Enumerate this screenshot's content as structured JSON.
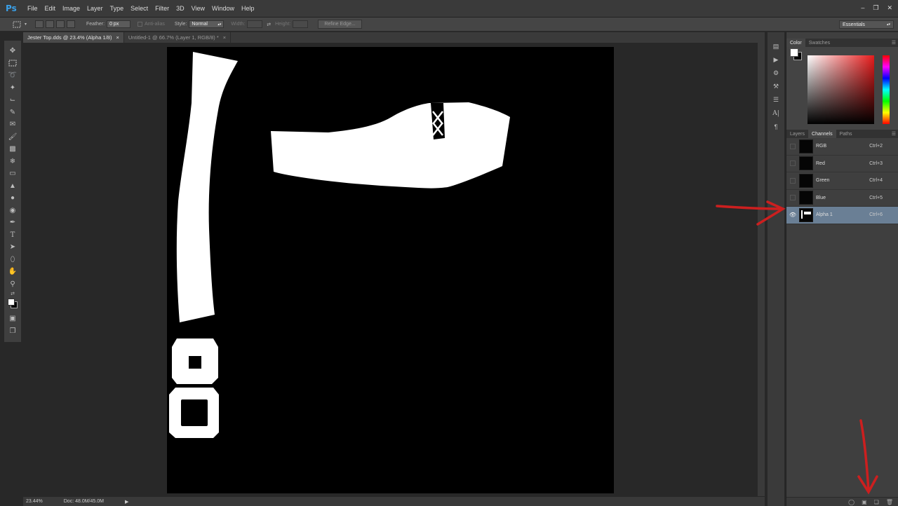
{
  "app": {
    "logo": "Ps"
  },
  "menu": [
    "File",
    "Edit",
    "Image",
    "Layer",
    "Type",
    "Select",
    "Filter",
    "3D",
    "View",
    "Window",
    "Help"
  ],
  "window_controls": [
    "minimize-icon",
    "restore-icon",
    "close-icon"
  ],
  "options": {
    "feather_label": "Feather:",
    "feather_value": "0 px",
    "antialias_label": "Anti-alias",
    "style_label": "Style:",
    "style_value": "Normal",
    "width_label": "Width:",
    "height_label": "Height:",
    "refine_edge": "Refine Edge...",
    "workspace": "Essentials"
  },
  "tabs": [
    {
      "label": "Jester Top.dds @ 23.4% (Alpha 1/8)",
      "close": "×"
    },
    {
      "label": "Untitled-1 @ 66.7% (Layer 1, RGB/8) *",
      "close": "×"
    }
  ],
  "status": {
    "zoom": "23.44%",
    "doc": "Doc: 48.0M/45.0M"
  },
  "color_panel": {
    "tabs": [
      "Color",
      "Swatches"
    ]
  },
  "channels_panel": {
    "tabs": [
      "Layers",
      "Channels",
      "Paths"
    ],
    "rows": [
      {
        "name": "RGB",
        "shortcut": "Ctrl+2",
        "visible": false
      },
      {
        "name": "Red",
        "shortcut": "Ctrl+3",
        "visible": false
      },
      {
        "name": "Green",
        "shortcut": "Ctrl+4",
        "visible": false
      },
      {
        "name": "Blue",
        "shortcut": "Ctrl+5",
        "visible": false
      },
      {
        "name": "Alpha 1",
        "shortcut": "Ctrl+6",
        "visible": true,
        "selected": true
      }
    ]
  },
  "colors": {
    "accent_selected": "#6a7f95",
    "annotation_red": "#cc1f1f",
    "ps_blue": "#3aa0e8"
  }
}
